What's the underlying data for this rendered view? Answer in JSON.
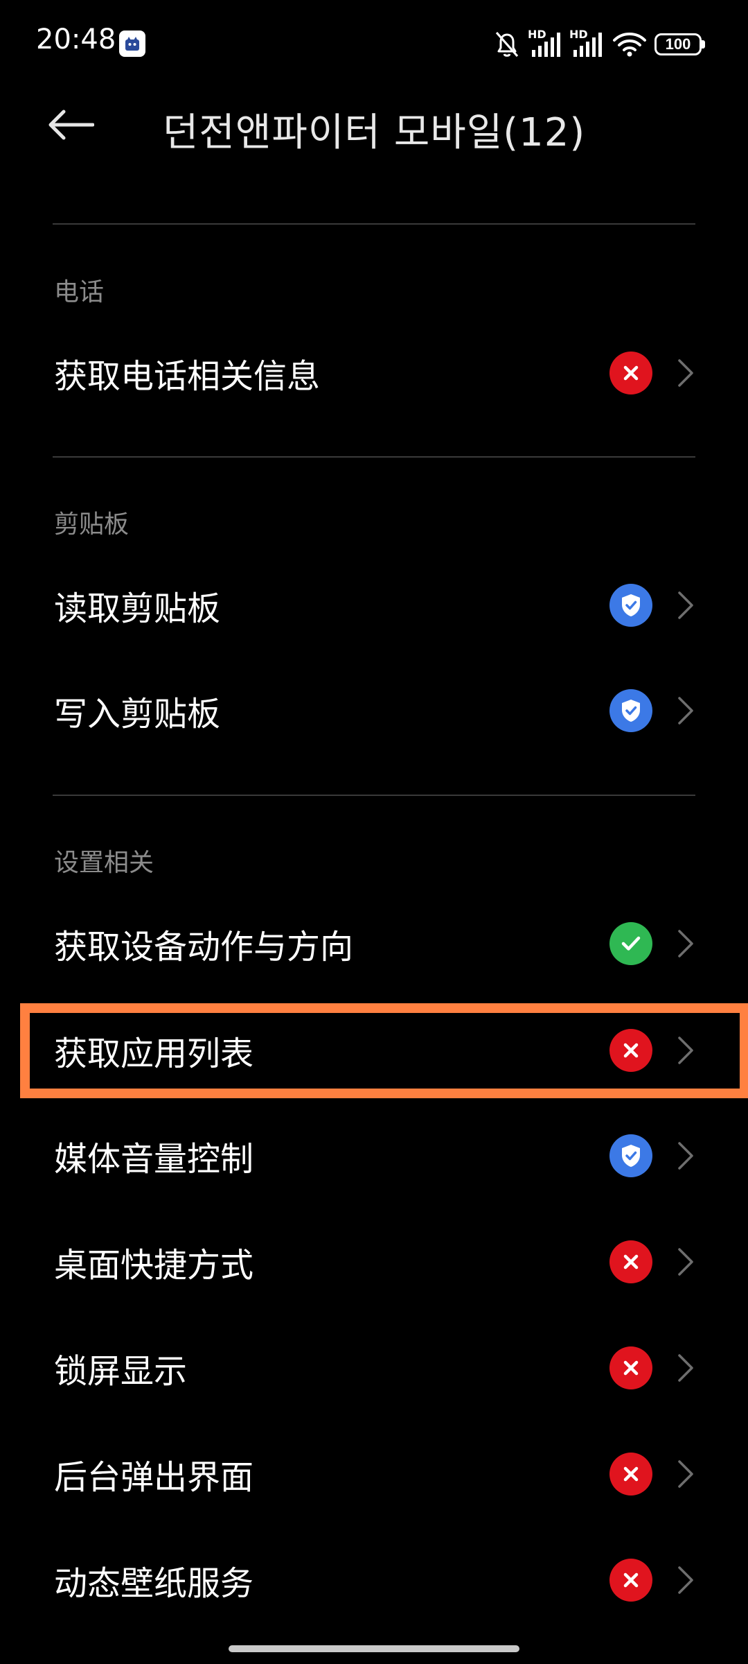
{
  "status_bar": {
    "time": "20:48",
    "icons": [
      "app-notification-icon",
      "mute-bell-icon",
      "hd-signal-icon",
      "hd-signal-icon",
      "wifi-icon",
      "battery-icon"
    ],
    "hd_label": "HD",
    "battery_level": "100"
  },
  "header": {
    "back_icon": "back-arrow-icon",
    "title": "던전앤파이터 모바일(12)"
  },
  "sections": [
    {
      "title": "电话",
      "items": [
        {
          "label": "获取电话相关信息",
          "status": "denied"
        }
      ]
    },
    {
      "title": "剪贴板",
      "items": [
        {
          "label": "读取剪贴板",
          "status": "ask"
        },
        {
          "label": "写入剪贴板",
          "status": "ask"
        }
      ]
    },
    {
      "title": "设置相关",
      "items": [
        {
          "label": "获取设备动作与方向",
          "status": "allowed"
        },
        {
          "label": "获取应用列表",
          "status": "denied"
        },
        {
          "label": "媒体音量控制",
          "status": "ask"
        },
        {
          "label": "桌面快捷方式",
          "status": "denied"
        },
        {
          "label": "锁屏显示",
          "status": "denied"
        },
        {
          "label": "后台弹出界面",
          "status": "denied"
        },
        {
          "label": "动态壁纸服务",
          "status": "denied"
        }
      ]
    }
  ],
  "colors": {
    "denied": "#e0141e",
    "ask": "#3c79e6",
    "allowed": "#2fb853",
    "highlight": "#ff8040"
  },
  "icons": {
    "denied": "x-circle-icon",
    "ask": "shield-check-icon",
    "allowed": "check-circle-icon",
    "chevron": "chevron-right-icon"
  }
}
